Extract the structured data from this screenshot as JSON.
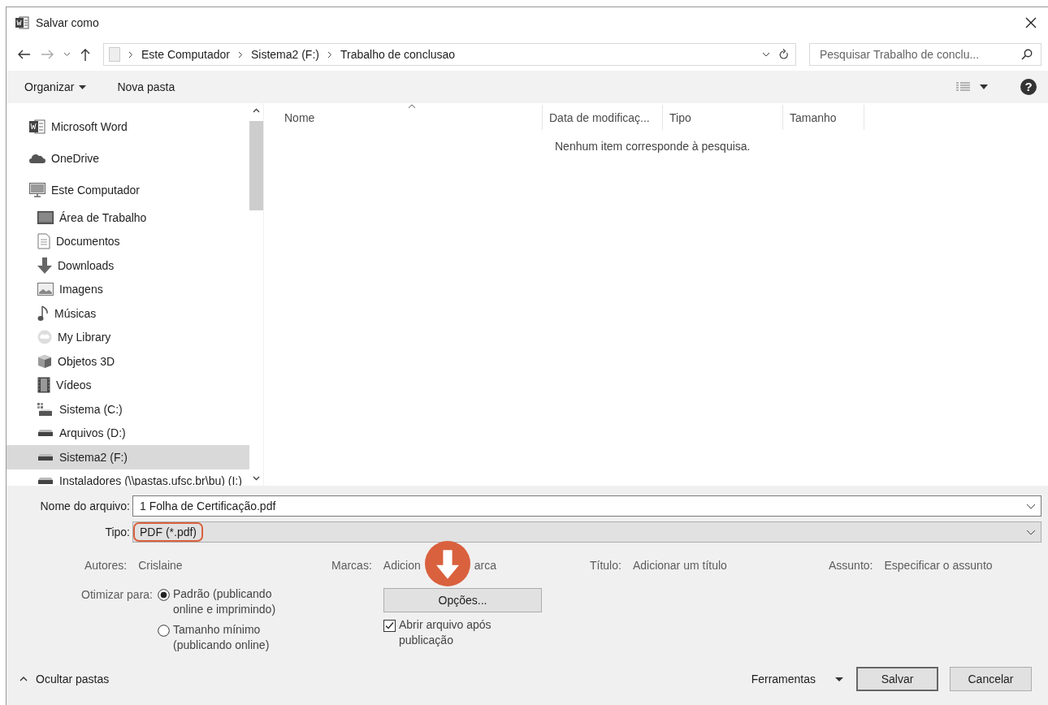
{
  "window": {
    "title": "Salvar como"
  },
  "nav": {
    "breadcrumbs": [
      "Este Computador",
      "Sistema2 (F:)",
      "Trabalho de conclusao"
    ],
    "search": {
      "placeholder": "Pesquisar Trabalho de conclu..."
    }
  },
  "toolbar": {
    "organize": "Organizar",
    "new_folder": "Nova pasta",
    "help": "?"
  },
  "sidebar": {
    "items": [
      {
        "label": "Microsoft Word",
        "kind": "word",
        "selected": false
      },
      {
        "label": "OneDrive",
        "kind": "cloud",
        "selected": false
      },
      {
        "label": "Este Computador",
        "kind": "computer",
        "selected": false,
        "children": [
          {
            "label": "Área de Trabalho",
            "kind": "desktop",
            "selected": false
          },
          {
            "label": "Documentos",
            "kind": "document",
            "selected": false
          },
          {
            "label": "Downloads",
            "kind": "download",
            "selected": false
          },
          {
            "label": "Imagens",
            "kind": "images",
            "selected": false
          },
          {
            "label": "Músicas",
            "kind": "music",
            "selected": false
          },
          {
            "label": "My Library",
            "kind": "library",
            "selected": false
          },
          {
            "label": "Objetos 3D",
            "kind": "cube",
            "selected": false
          },
          {
            "label": "Vídeos",
            "kind": "video",
            "selected": false
          },
          {
            "label": "Sistema (C:)",
            "kind": "system-drive",
            "selected": false
          },
          {
            "label": "Arquivos (D:)",
            "kind": "drive",
            "selected": false
          },
          {
            "label": "Sistema2 (F:)",
            "kind": "drive",
            "selected": true
          },
          {
            "label": "Instaladores (\\\\pastas.ufsc.br\\bu) (I:)",
            "kind": "drive",
            "selected": false
          }
        ]
      }
    ]
  },
  "file_list": {
    "columns": [
      {
        "label": "Nome",
        "sorted": true
      },
      {
        "label": "Data de modificaç...",
        "sorted": false
      },
      {
        "label": "Tipo",
        "sorted": false
      },
      {
        "label": "Tamanho",
        "sorted": false
      }
    ],
    "empty_message": "Nenhum item corresponde à pesquisa."
  },
  "form": {
    "filename": {
      "label": "Nome do arquivo:",
      "value": "1 Folha de Certificação.pdf"
    },
    "type": {
      "label": "Tipo:",
      "value": "PDF (*.pdf)",
      "highlighted": true
    }
  },
  "metadata": [
    {
      "label": "Autores:",
      "value": "Crislaine"
    },
    {
      "label": "Marcas:",
      "value": "Adicion",
      "value_tail": "arca"
    },
    {
      "label": "Título:",
      "value": "Adicionar um título"
    },
    {
      "label": "Assunto:",
      "value": "Especificar o assunto"
    }
  ],
  "optimize": {
    "label": "Otimizar para:",
    "options": [
      {
        "label": "Padrão (publicando online e imprimindo)",
        "selected": true
      },
      {
        "label": "Tamanho mínimo (publicando online)",
        "selected": false
      }
    ]
  },
  "options_button": "Opções...",
  "open_after": {
    "label": "Abrir arquivo após publicação",
    "checked": true
  },
  "footer": {
    "hide_folders": "Ocultar pastas",
    "tools": "Ferramentas",
    "save": "Salvar",
    "cancel": "Cancelar"
  }
}
